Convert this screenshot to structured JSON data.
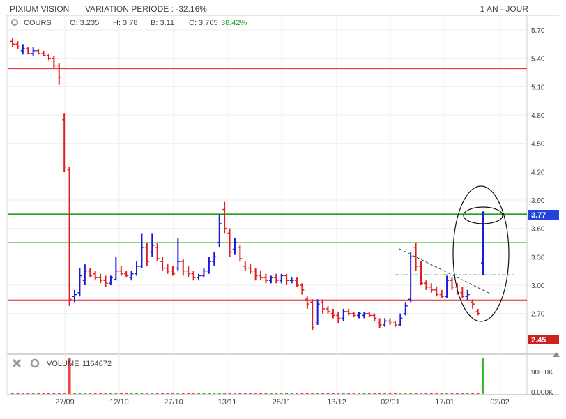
{
  "header": {
    "name": "PIXIUM VISION",
    "variation_label": "VARIATION PERIODE : -32.16%",
    "period": "1 AN - JOUR"
  },
  "price_panel": {
    "series_label": "COURS",
    "open": "O: 3.235",
    "high": "H: 3.78",
    "low": "B: 3.11",
    "close": "C: 3.765",
    "change": "38.42%",
    "last_price_badge": "3.77",
    "low_badge": "2.45"
  },
  "volume_panel": {
    "label": "VOLUME",
    "value": "1164672",
    "tick_high": "900.0K",
    "tick_low": "0.000K"
  },
  "colors": {
    "up": "#1a1adb",
    "down": "#e02020",
    "resistance_red": "#e02020",
    "support_green": "#20a020",
    "badge_blue": "#2244dd",
    "badge_red": "#cc2222"
  },
  "chart_data": [
    {
      "type": "ohlc",
      "title": "PIXIUM VISION",
      "y_ticks": [
        5.7,
        5.4,
        5.1,
        4.8,
        4.5,
        4.2,
        3.9,
        3.6,
        3.3,
        3.0,
        2.7,
        2.45
      ],
      "y_tick_labels": [
        "5.70",
        "5.40",
        "5.10",
        "4.80",
        "4.50",
        "4.20",
        "3.90",
        "3.60",
        "3.30",
        "3.00",
        "2.70"
      ],
      "x_ticks": [
        "27/09",
        "12/10",
        "27/10",
        "13/11",
        "28/11",
        "13/12",
        "02/01",
        "17/01",
        "02/02"
      ],
      "ylim": [
        2.4,
        5.8
      ],
      "grid": true,
      "bars": [
        [
          5.58,
          5.62,
          5.52,
          5.55
        ],
        [
          5.55,
          5.58,
          5.5,
          5.52
        ],
        [
          5.48,
          5.55,
          5.44,
          5.5
        ],
        [
          5.5,
          5.52,
          5.44,
          5.45
        ],
        [
          5.45,
          5.52,
          5.42,
          5.48
        ],
        [
          5.48,
          5.5,
          5.44,
          5.45
        ],
        [
          5.45,
          5.48,
          5.42,
          5.43
        ],
        [
          5.43,
          5.45,
          5.38,
          5.4
        ],
        [
          5.4,
          5.42,
          5.3,
          5.32
        ],
        [
          5.32,
          5.35,
          5.12,
          5.2
        ],
        [
          4.75,
          4.82,
          4.2,
          4.25
        ],
        [
          4.22,
          4.25,
          2.78,
          2.85
        ],
        [
          2.88,
          2.95,
          2.82,
          2.9
        ],
        [
          2.92,
          3.18,
          2.88,
          3.1
        ],
        [
          3.05,
          3.22,
          3.0,
          3.15
        ],
        [
          3.15,
          3.18,
          3.08,
          3.1
        ],
        [
          3.12,
          3.15,
          3.05,
          3.08
        ],
        [
          3.08,
          3.12,
          3.02,
          3.05
        ],
        [
          3.05,
          3.1,
          2.98,
          3.02
        ],
        [
          3.02,
          3.1,
          3.0,
          3.08
        ],
        [
          3.06,
          3.3,
          3.05,
          3.15
        ],
        [
          3.15,
          3.2,
          3.1,
          3.12
        ],
        [
          3.12,
          3.15,
          3.08,
          3.1
        ],
        [
          3.08,
          3.15,
          3.05,
          3.12
        ],
        [
          3.12,
          3.25,
          3.1,
          3.2
        ],
        [
          3.2,
          3.55,
          3.18,
          3.4
        ],
        [
          3.4,
          3.45,
          3.2,
          3.25
        ],
        [
          3.35,
          3.55,
          3.3,
          3.42
        ],
        [
          3.4,
          3.45,
          3.25,
          3.28
        ],
        [
          3.25,
          3.3,
          3.15,
          3.18
        ],
        [
          3.18,
          3.22,
          3.12,
          3.15
        ],
        [
          3.15,
          3.2,
          3.1,
          3.12
        ],
        [
          3.18,
          3.5,
          3.15,
          3.25
        ],
        [
          3.25,
          3.28,
          3.1,
          3.15
        ],
        [
          3.15,
          3.2,
          3.08,
          3.12
        ],
        [
          3.12,
          3.15,
          3.05,
          3.08
        ],
        [
          3.08,
          3.12,
          3.05,
          3.1
        ],
        [
          3.1,
          3.18,
          3.08,
          3.15
        ],
        [
          3.15,
          3.3,
          3.12,
          3.25
        ],
        [
          3.25,
          3.35,
          3.2,
          3.3
        ],
        [
          3.45,
          3.75,
          3.4,
          3.65
        ],
        [
          3.8,
          3.88,
          3.55,
          3.6
        ],
        [
          3.55,
          3.6,
          3.3,
          3.35
        ],
        [
          3.38,
          3.5,
          3.32,
          3.45
        ],
        [
          3.4,
          3.42,
          3.25,
          3.28
        ],
        [
          3.2,
          3.25,
          3.15,
          3.18
        ],
        [
          3.18,
          3.22,
          3.12,
          3.15
        ],
        [
          3.15,
          3.18,
          3.05,
          3.1
        ],
        [
          3.1,
          3.15,
          3.05,
          3.08
        ],
        [
          3.08,
          3.12,
          3.02,
          3.05
        ],
        [
          3.05,
          3.1,
          3.02,
          3.08
        ],
        [
          3.08,
          3.12,
          3.02,
          3.05
        ],
        [
          3.05,
          3.12,
          3.02,
          3.1
        ],
        [
          3.1,
          3.12,
          3.0,
          3.05
        ],
        [
          3.05,
          3.08,
          3.02,
          3.05
        ],
        [
          3.05,
          3.08,
          2.98,
          3.0
        ],
        [
          3.0,
          3.02,
          2.9,
          2.95
        ],
        [
          2.85,
          2.88,
          2.75,
          2.8
        ],
        [
          2.82,
          2.85,
          2.52,
          2.55
        ],
        [
          2.6,
          2.85,
          2.58,
          2.8
        ],
        [
          2.82,
          2.85,
          2.7,
          2.75
        ],
        [
          2.75,
          2.78,
          2.7,
          2.72
        ],
        [
          2.7,
          2.75,
          2.65,
          2.68
        ],
        [
          2.68,
          2.72,
          2.6,
          2.65
        ],
        [
          2.65,
          2.75,
          2.62,
          2.72
        ],
        [
          2.72,
          2.75,
          2.68,
          2.7
        ],
        [
          2.7,
          2.72,
          2.66,
          2.68
        ],
        [
          2.68,
          2.72,
          2.65,
          2.7
        ],
        [
          2.68,
          2.72,
          2.65,
          2.7
        ],
        [
          2.7,
          2.72,
          2.66,
          2.68
        ],
        [
          2.68,
          2.7,
          2.62,
          2.65
        ],
        [
          2.6,
          2.65,
          2.55,
          2.58
        ],
        [
          2.58,
          2.65,
          2.56,
          2.62
        ],
        [
          2.62,
          2.65,
          2.58,
          2.6
        ],
        [
          2.6,
          2.62,
          2.56,
          2.58
        ],
        [
          2.58,
          2.7,
          2.57,
          2.65
        ],
        [
          2.7,
          2.82,
          2.68,
          2.78
        ],
        [
          2.85,
          3.35,
          2.82,
          3.3
        ],
        [
          3.4,
          3.45,
          3.15,
          3.2
        ],
        [
          3.2,
          3.25,
          3.0,
          3.02
        ],
        [
          3.02,
          3.05,
          2.95,
          2.98
        ],
        [
          2.98,
          3.02,
          2.92,
          2.95
        ],
        [
          2.95,
          2.98,
          2.88,
          2.9
        ],
        [
          2.9,
          2.95,
          2.86,
          2.88
        ],
        [
          2.88,
          3.1,
          2.86,
          3.05
        ],
        [
          3.05,
          3.08,
          2.95,
          2.98
        ],
        [
          2.98,
          3.02,
          2.9,
          2.92
        ],
        [
          2.92,
          2.98,
          2.86,
          2.88
        ],
        [
          2.88,
          2.95,
          2.84,
          2.9
        ],
        [
          2.82,
          2.85,
          2.75,
          2.8
        ],
        [
          2.72,
          2.75,
          2.68,
          2.7
        ],
        [
          3.235,
          3.78,
          3.11,
          3.765
        ]
      ],
      "horizontal_lines": [
        {
          "value": 5.29,
          "color": "red"
        },
        {
          "value": 3.75,
          "color": "green"
        },
        {
          "value": 3.45,
          "color": "green"
        },
        {
          "value": 2.84,
          "color": "red"
        },
        {
          "value": 3.11,
          "color": "green",
          "style": "dash-dot"
        }
      ]
    },
    {
      "type": "bar",
      "title": "VOLUME",
      "values": [
        20,
        15,
        18,
        12,
        10,
        14,
        16,
        12,
        25,
        40,
        60,
        1164672,
        120,
        90,
        60,
        40,
        30,
        28,
        25,
        22,
        35,
        30,
        25,
        22,
        28,
        70,
        40,
        45,
        30,
        28,
        25,
        20,
        60,
        45,
        35,
        28,
        22,
        26,
        30,
        32,
        90,
        120,
        70,
        50,
        40,
        30,
        28,
        26,
        22,
        20,
        24,
        22,
        26,
        20,
        18,
        22,
        35,
        60,
        90,
        70,
        45,
        40,
        35,
        30,
        38,
        30,
        28,
        26,
        24,
        22,
        28,
        30,
        26,
        24,
        22,
        30,
        45,
        110,
        95,
        60,
        40,
        35,
        30,
        28,
        55,
        40,
        35,
        30,
        28,
        26,
        30,
        1164672
      ],
      "ylim": [
        0,
        1200000
      ]
    }
  ]
}
